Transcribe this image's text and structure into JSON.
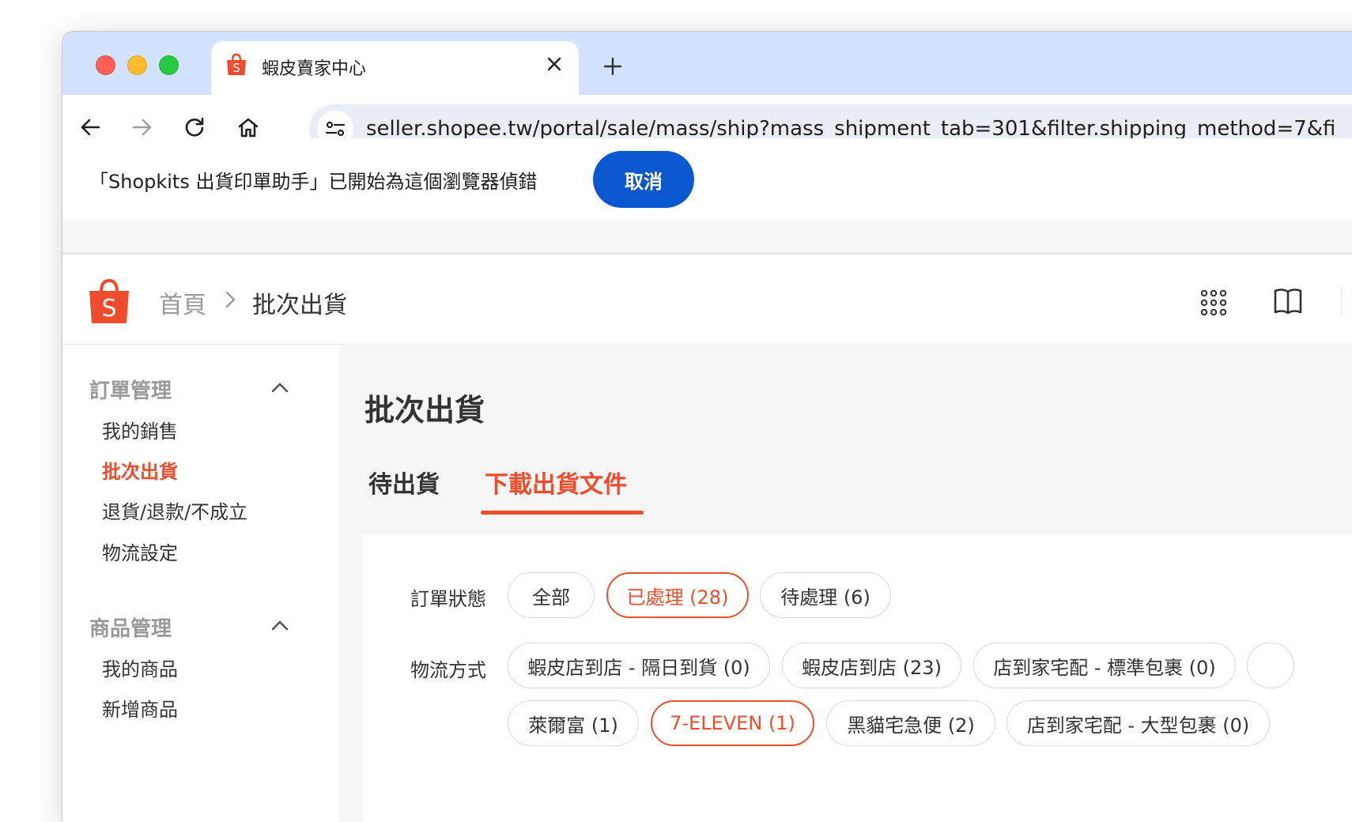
{
  "browser": {
    "tab_title": "蝦皮賣家中心",
    "url": "seller.shopee.tw/portal/sale/mass/ship?mass_shipment_tab=301&filter.shipping_method=7&fi"
  },
  "infobar": {
    "message": "「Shopkits 出貨印單助手」已開始為這個瀏覽器偵錯",
    "cancel_label": "取消"
  },
  "header": {
    "breadcrumb_home": "首頁",
    "breadcrumb_current": "批次出貨"
  },
  "sidebar": {
    "groups": [
      {
        "title": "訂單管理",
        "items": [
          "我的銷售",
          "批次出貨",
          "退貨/退款/不成立",
          "物流設定"
        ]
      },
      {
        "title": "商品管理",
        "items": [
          "我的商品",
          "新增商品"
        ]
      }
    ],
    "active_item": "批次出貨"
  },
  "main": {
    "title": "批次出貨",
    "tabs": [
      "待出貨",
      "下載出貨文件"
    ],
    "active_tab": "下載出貨文件",
    "filters": {
      "status_label": "訂單狀態",
      "status_options": [
        "全部",
        "已處理 (28)",
        "待處理 (6)"
      ],
      "status_selected": "已處理 (28)",
      "shipping_label": "物流方式",
      "shipping_options": [
        "蝦皮店到店 - 隔日到貨 (0)",
        "蝦皮店到店 (23)",
        "店到家宅配 - 標準包裹 (0)",
        "萊爾富 (1)",
        "7-ELEVEN (1)",
        "黑貓宅急便 (2)",
        "店到家宅配 - 大型包裹 (0)"
      ],
      "shipping_selected": "7-ELEVEN (1)"
    }
  },
  "colors": {
    "accent": "#ee4d2d",
    "chrome_blue": "#0b57d0",
    "tabstrip": "#d3e3fd"
  }
}
